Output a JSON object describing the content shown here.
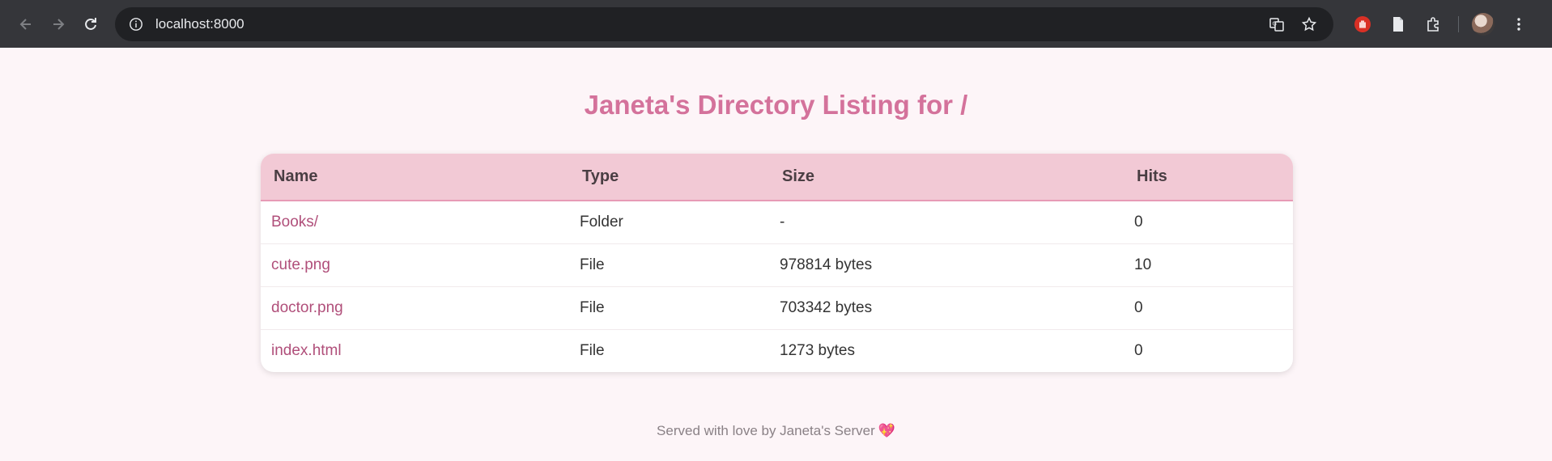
{
  "browser": {
    "url": "localhost:8000",
    "icons": [
      "back-arrow-icon",
      "forward-arrow-icon",
      "reload-icon",
      "site-info-icon",
      "translate-icon",
      "bookmark-star-icon",
      "stop-hand-extension-icon",
      "document-extension-icon",
      "extensions-puzzle-icon",
      "profile-avatar",
      "kebab-menu-icon"
    ]
  },
  "page": {
    "title": "Janeta's Directory Listing for /",
    "footer_text": "Served with love by Janeta's Server",
    "footer_emoji": "💖"
  },
  "table": {
    "headers": [
      "Name",
      "Type",
      "Size",
      "Hits"
    ],
    "rows": [
      {
        "name": "Books/",
        "type": "Folder",
        "size": "-",
        "hits": "0"
      },
      {
        "name": "cute.png",
        "type": "File",
        "size": "978814 bytes",
        "hits": "10"
      },
      {
        "name": "doctor.png",
        "type": "File",
        "size": "703342 bytes",
        "hits": "0"
      },
      {
        "name": "index.html",
        "type": "File",
        "size": "1273 bytes",
        "hits": "0"
      }
    ]
  },
  "colors": {
    "title": "#d4729b",
    "header_bg": "#f2c9d5",
    "link": "#b04f7a",
    "page_bg": "#fdf5f8"
  }
}
